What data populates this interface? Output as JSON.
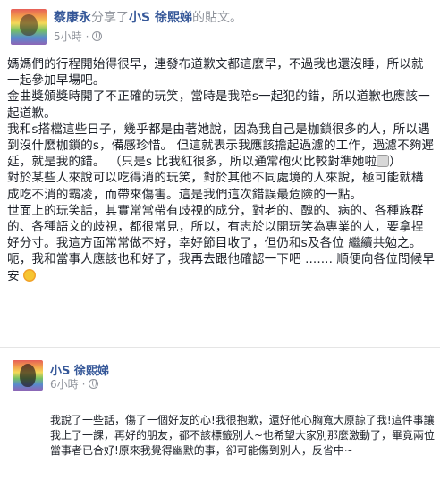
{
  "post": {
    "author": "蔡康永",
    "action": "分享了",
    "shared_author": "小S 徐熙娣",
    "shared_suffix": "的貼文。",
    "time": "5小時",
    "paragraphs": [
      "媽媽們的行程開始得很早，連發布道歉文都這麼早，不過我也還沒睡，所以就一起參加早場吧。",
      "金曲獎頒獎時開了不正確的玩笑，當時是我陪s一起犯的錯，所以道歉也應該一起道歉。",
      "我和s搭檔這些日子，幾乎都是由著她說，因為我自己是枷鎖很多的人，所以遇到沒什麼枷鎖的s，備感珍惜。 但這就表示我應該擔起過濾的工作，過濾不夠遲延，就是我的錯。 （只是s 比我紅很多，所以通常砲火比較對準她啦",
      "對於某些人來說可以吃得消的玩笑，對於其他不同處境的人來說，極可能就構成吃不消的霸凌，而帶來傷害。這是我們這次錯誤最危險的一點。",
      "世面上的玩笑話，其實常常帶有歧視的成分，對老的、醜的、病的、各種族群的、各種語文的歧視，都很常見，所以，有志於以開玩笑為專業的人，要拿捏好分寸。我這方面常常做不好，幸好節目收了，但仍和s及各位 繼續共勉之。",
      "呃，我和當事人應該也和好了，我再去跟他確認一下吧 ....... 順便向各位問候早安"
    ],
    "paragraph3_end": "）",
    "emoji_face": "face-emoji",
    "emoji_sun": "sun-emoji"
  },
  "quote": {
    "author": "小S 徐熙娣",
    "time": "6小時",
    "text": "我說了一些話，傷了一個好友的心!我很抱歉，還好他心胸寬大原諒了我!這件事讓我上了一課，再好的朋友，都不該標籤別人~也希望大家別那麼激動了，畢竟兩位當事者已合好!原來我覺得幽默的事，卻可能傷到別人，反省中~"
  },
  "colors": {
    "link": "#365899",
    "meta": "#90949c",
    "text": "#1d2129"
  }
}
